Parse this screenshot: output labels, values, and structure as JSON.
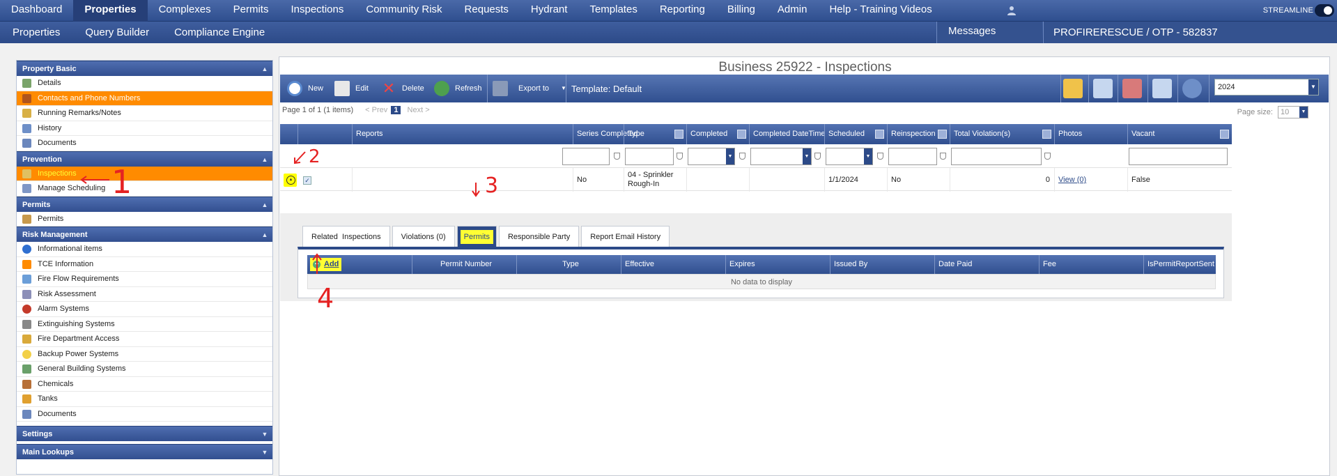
{
  "topnav": {
    "items": [
      "Dashboard",
      "Properties",
      "Complexes",
      "Permits",
      "Inspections",
      "Community Risk",
      "Requests",
      "Hydrant",
      "Templates",
      "Reporting",
      "Billing",
      "Admin",
      "Help - Training Videos"
    ],
    "active": "Properties",
    "brand": "STREAMLINE"
  },
  "subnav": {
    "items": [
      "Properties",
      "Query Builder",
      "Compliance Engine"
    ],
    "messages": "Messages",
    "account": "PROFIRERESCUE / OTP - 582837"
  },
  "sidebar": {
    "sections": [
      {
        "title": "Property Basic",
        "items": [
          "Details",
          "Contacts and Phone Numbers",
          "Running Remarks/Notes",
          "History",
          "Documents"
        ]
      },
      {
        "title": "Prevention",
        "items": [
          "Inspections",
          "Manage Scheduling"
        ]
      },
      {
        "title": "Permits",
        "items": [
          "Permits"
        ]
      },
      {
        "title": "Risk Management",
        "items": [
          "Informational items",
          "TCE Information",
          "Fire Flow Requirements",
          "Risk Assessment",
          "Alarm Systems",
          "Extinguishing Systems",
          "Fire Department Access",
          "Backup Power Systems",
          "General Building Systems",
          "Chemicals",
          "Tanks",
          "Documents"
        ]
      },
      {
        "title": "Settings",
        "items": []
      },
      {
        "title": "Main Lookups",
        "items": []
      }
    ]
  },
  "page": {
    "title": "Business 25922 - Inspections"
  },
  "toolbar": {
    "new": "New",
    "edit": "Edit",
    "delete": "Delete",
    "refresh": "Refresh",
    "export": "Export to",
    "template": "Template: Default",
    "year": "2024"
  },
  "pager": {
    "info": "Page 1 of 1 (1 items)",
    "prev": "< Prev",
    "current": "1",
    "next": "Next >",
    "page_size_label": "Page size:",
    "page_size": "10"
  },
  "grid": {
    "columns": [
      "Reports",
      "Series Completed",
      "Type",
      "Completed",
      "Completed DateTime",
      "Scheduled",
      "Reinspection",
      "Total Violation(s)",
      "Photos",
      "Vacant"
    ],
    "row": {
      "series_completed": "No",
      "type_line1": "04 - Sprinkler",
      "type_line2": "Rough-In",
      "scheduled": "1/1/2024",
      "reinspection": "No",
      "total_violations": "0",
      "photos": "View (0)",
      "vacant": "False"
    }
  },
  "detail_tabs": [
    "Related  Inspections",
    "Violations (0)",
    "Permits",
    "Responsible Party",
    "Report Email History"
  ],
  "permits_grid": {
    "add": "Add",
    "columns": [
      "Permit Number",
      "Type",
      "Effective",
      "Expires",
      "Issued By",
      "Date Paid",
      "Fee",
      "IsPermitReportSent"
    ],
    "empty": "No data to display"
  },
  "annotations": [
    "2",
    "1",
    "3",
    "4"
  ],
  "colors": {
    "nav": "#2f4f8f",
    "selected": "#ff8b00",
    "highlight": "#ffff33",
    "annotation": "#e52222"
  }
}
